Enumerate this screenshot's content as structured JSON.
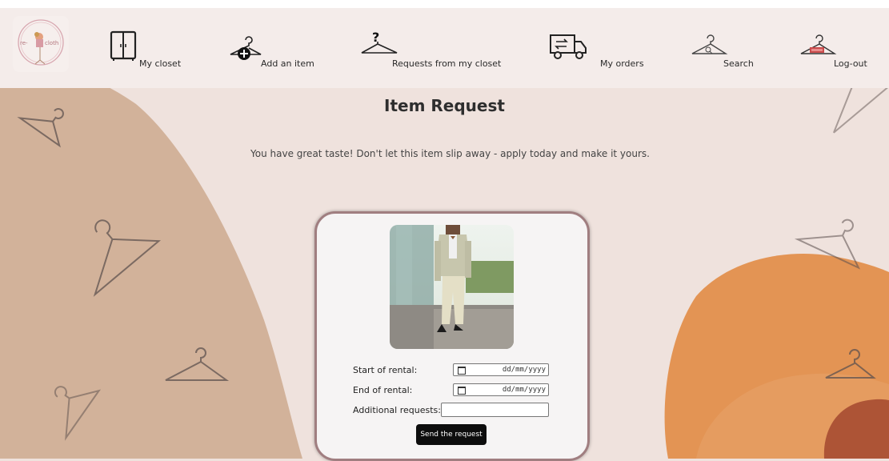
{
  "logo": {
    "text_left": "re-",
    "text_right": "cloth"
  },
  "nav": {
    "my_closet": "My closet",
    "add_item": "Add an item",
    "requests": "Requests from my closet",
    "my_orders": "My orders",
    "search": "Search",
    "logout": "Log-out"
  },
  "page": {
    "title": "Item Request",
    "subtitle": "You have great taste! Don't let this item slip away - apply today and make it yours."
  },
  "form": {
    "start_label": "Start of rental:",
    "start_placeholder": "dd/mm/yyyy",
    "end_label": "End of rental:",
    "end_placeholder": "dd/mm/yyyy",
    "additional_label": "Additional requests:",
    "additional_value": "",
    "submit_label": "Send the request"
  },
  "colors": {
    "background": "#efe2dd",
    "nav_bg": "#f4ecea",
    "tan_blob": "#d2b29a",
    "orange_blob": "#e39454",
    "dark_blob": "#ad5436",
    "card_border": "#a07e80",
    "button_bg": "#0d0d0d"
  }
}
